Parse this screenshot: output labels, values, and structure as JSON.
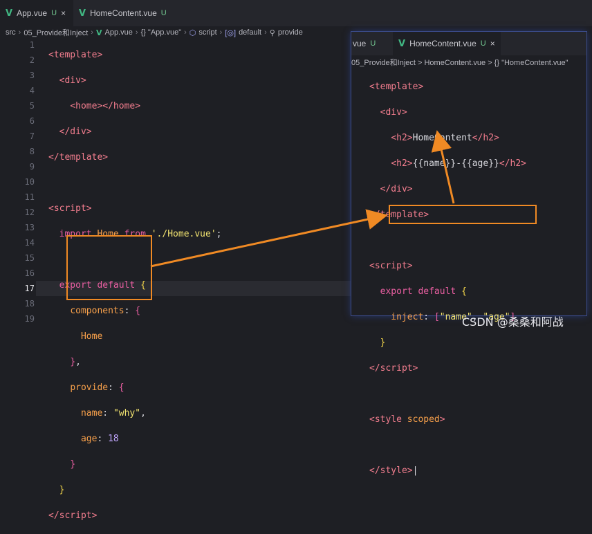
{
  "tabs": [
    {
      "label": "App.vue",
      "status": "U"
    },
    {
      "label": "HomeContent.vue",
      "status": "U"
    }
  ],
  "breadcrumb": {
    "segments": [
      "src",
      "05_Provide和Inject",
      "App.vue",
      "{} \"App.vue\"",
      "script",
      "default",
      "provide"
    ]
  },
  "editor_left": {
    "line_numbers": [
      "1",
      "2",
      "3",
      "4",
      "5",
      "6",
      "7",
      "8",
      "9",
      "10",
      "11",
      "12",
      "13",
      "14",
      "15",
      "16",
      "17",
      "18",
      "19"
    ]
  },
  "right_panel": {
    "tabs": [
      {
        "label": "vue",
        "status": "U"
      },
      {
        "label": "HomeContent.vue",
        "status": "U"
      }
    ],
    "breadcrumb": "05_Provide和Inject > HomeContent.vue > {} \"HomeContent.vue\""
  },
  "watermark": "CSDN @桑桑和阿战",
  "colors": {
    "accent": "#f08a24",
    "vue": "#41b883"
  }
}
